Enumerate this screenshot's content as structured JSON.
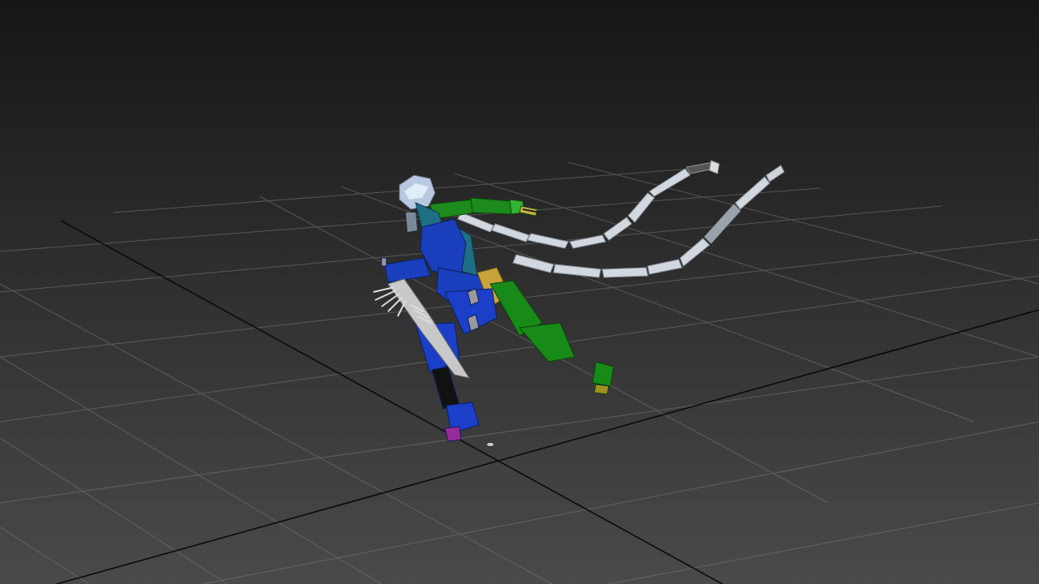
{
  "viewport": {
    "kind": "3d-perspective-viewport",
    "background_top": "#161616",
    "background_bottom": "#4a4a4a",
    "grid_color": "#7a7a7a",
    "axis_color": "#0a0a0a",
    "grid_visible": true
  },
  "character_rig": {
    "head_color": "#b8c8e0",
    "spine_color": "#1e6e86",
    "torso_color": "#1a3fbd",
    "left_arm_color": "#1c8a1c",
    "right_arm_color": "#1a3fbd",
    "left_leg_color": "#178a17",
    "right_leg_color": "#1b3fc8",
    "pelvis_color": "#c9a23a",
    "foot_marker_color": "#9a2a9a",
    "weapon_color": "#c8c8c8",
    "tail_color": "#d2d8e0"
  }
}
